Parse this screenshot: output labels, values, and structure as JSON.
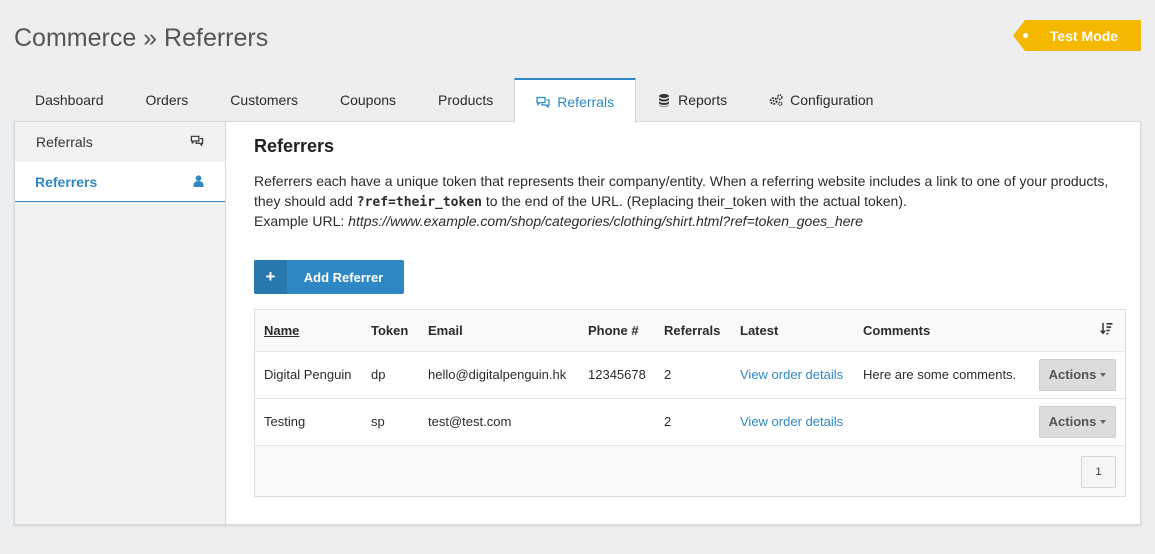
{
  "page": {
    "title": "Commerce » Referrers",
    "mode_badge": "Test Mode"
  },
  "tabs": [
    {
      "label": "Dashboard",
      "icon": ""
    },
    {
      "label": "Orders",
      "icon": ""
    },
    {
      "label": "Customers",
      "icon": ""
    },
    {
      "label": "Coupons",
      "icon": ""
    },
    {
      "label": "Products",
      "icon": ""
    },
    {
      "label": "Referrals",
      "icon": "comments-icon",
      "active": true
    },
    {
      "label": "Reports",
      "icon": "database-icon"
    },
    {
      "label": "Configuration",
      "icon": "gears-icon"
    }
  ],
  "sidenav": {
    "items": [
      {
        "label": "Referrals",
        "icon": "comments-icon"
      },
      {
        "label": "Referrers",
        "icon": "user-icon",
        "active": true
      }
    ]
  },
  "content": {
    "heading": "Referrers",
    "desc_part1": "Referrers each have a unique token that represents their company/entity. When a referring website includes a link to one of your products, they should add ",
    "desc_code": "?ref=their_token",
    "desc_part2": " to the end of the URL. (Replacing their_token with the actual token).",
    "example_label": "Example URL: ",
    "example_url": "https://www.example.com/shop/categories/clothing/shirt.html?ref=token_goes_here",
    "add_button": "Add Referrer"
  },
  "table": {
    "columns": [
      "Name",
      "Token",
      "Email",
      "Phone #",
      "Referrals",
      "Latest",
      "Comments"
    ],
    "rows": [
      {
        "name": "Digital Penguin",
        "token": "dp",
        "email": "hello@digitalpenguin.hk",
        "phone": "12345678",
        "referrals": "2",
        "latest": "View order details",
        "comments": "Here are some comments.",
        "action": "Actions"
      },
      {
        "name": "Testing",
        "token": "sp",
        "email": "test@test.com",
        "phone": "",
        "referrals": "2",
        "latest": "View order details",
        "comments": "",
        "action": "Actions"
      }
    ],
    "page": "1"
  },
  "colors": {
    "accent": "#2f88c4",
    "badge": "#f5b800"
  }
}
